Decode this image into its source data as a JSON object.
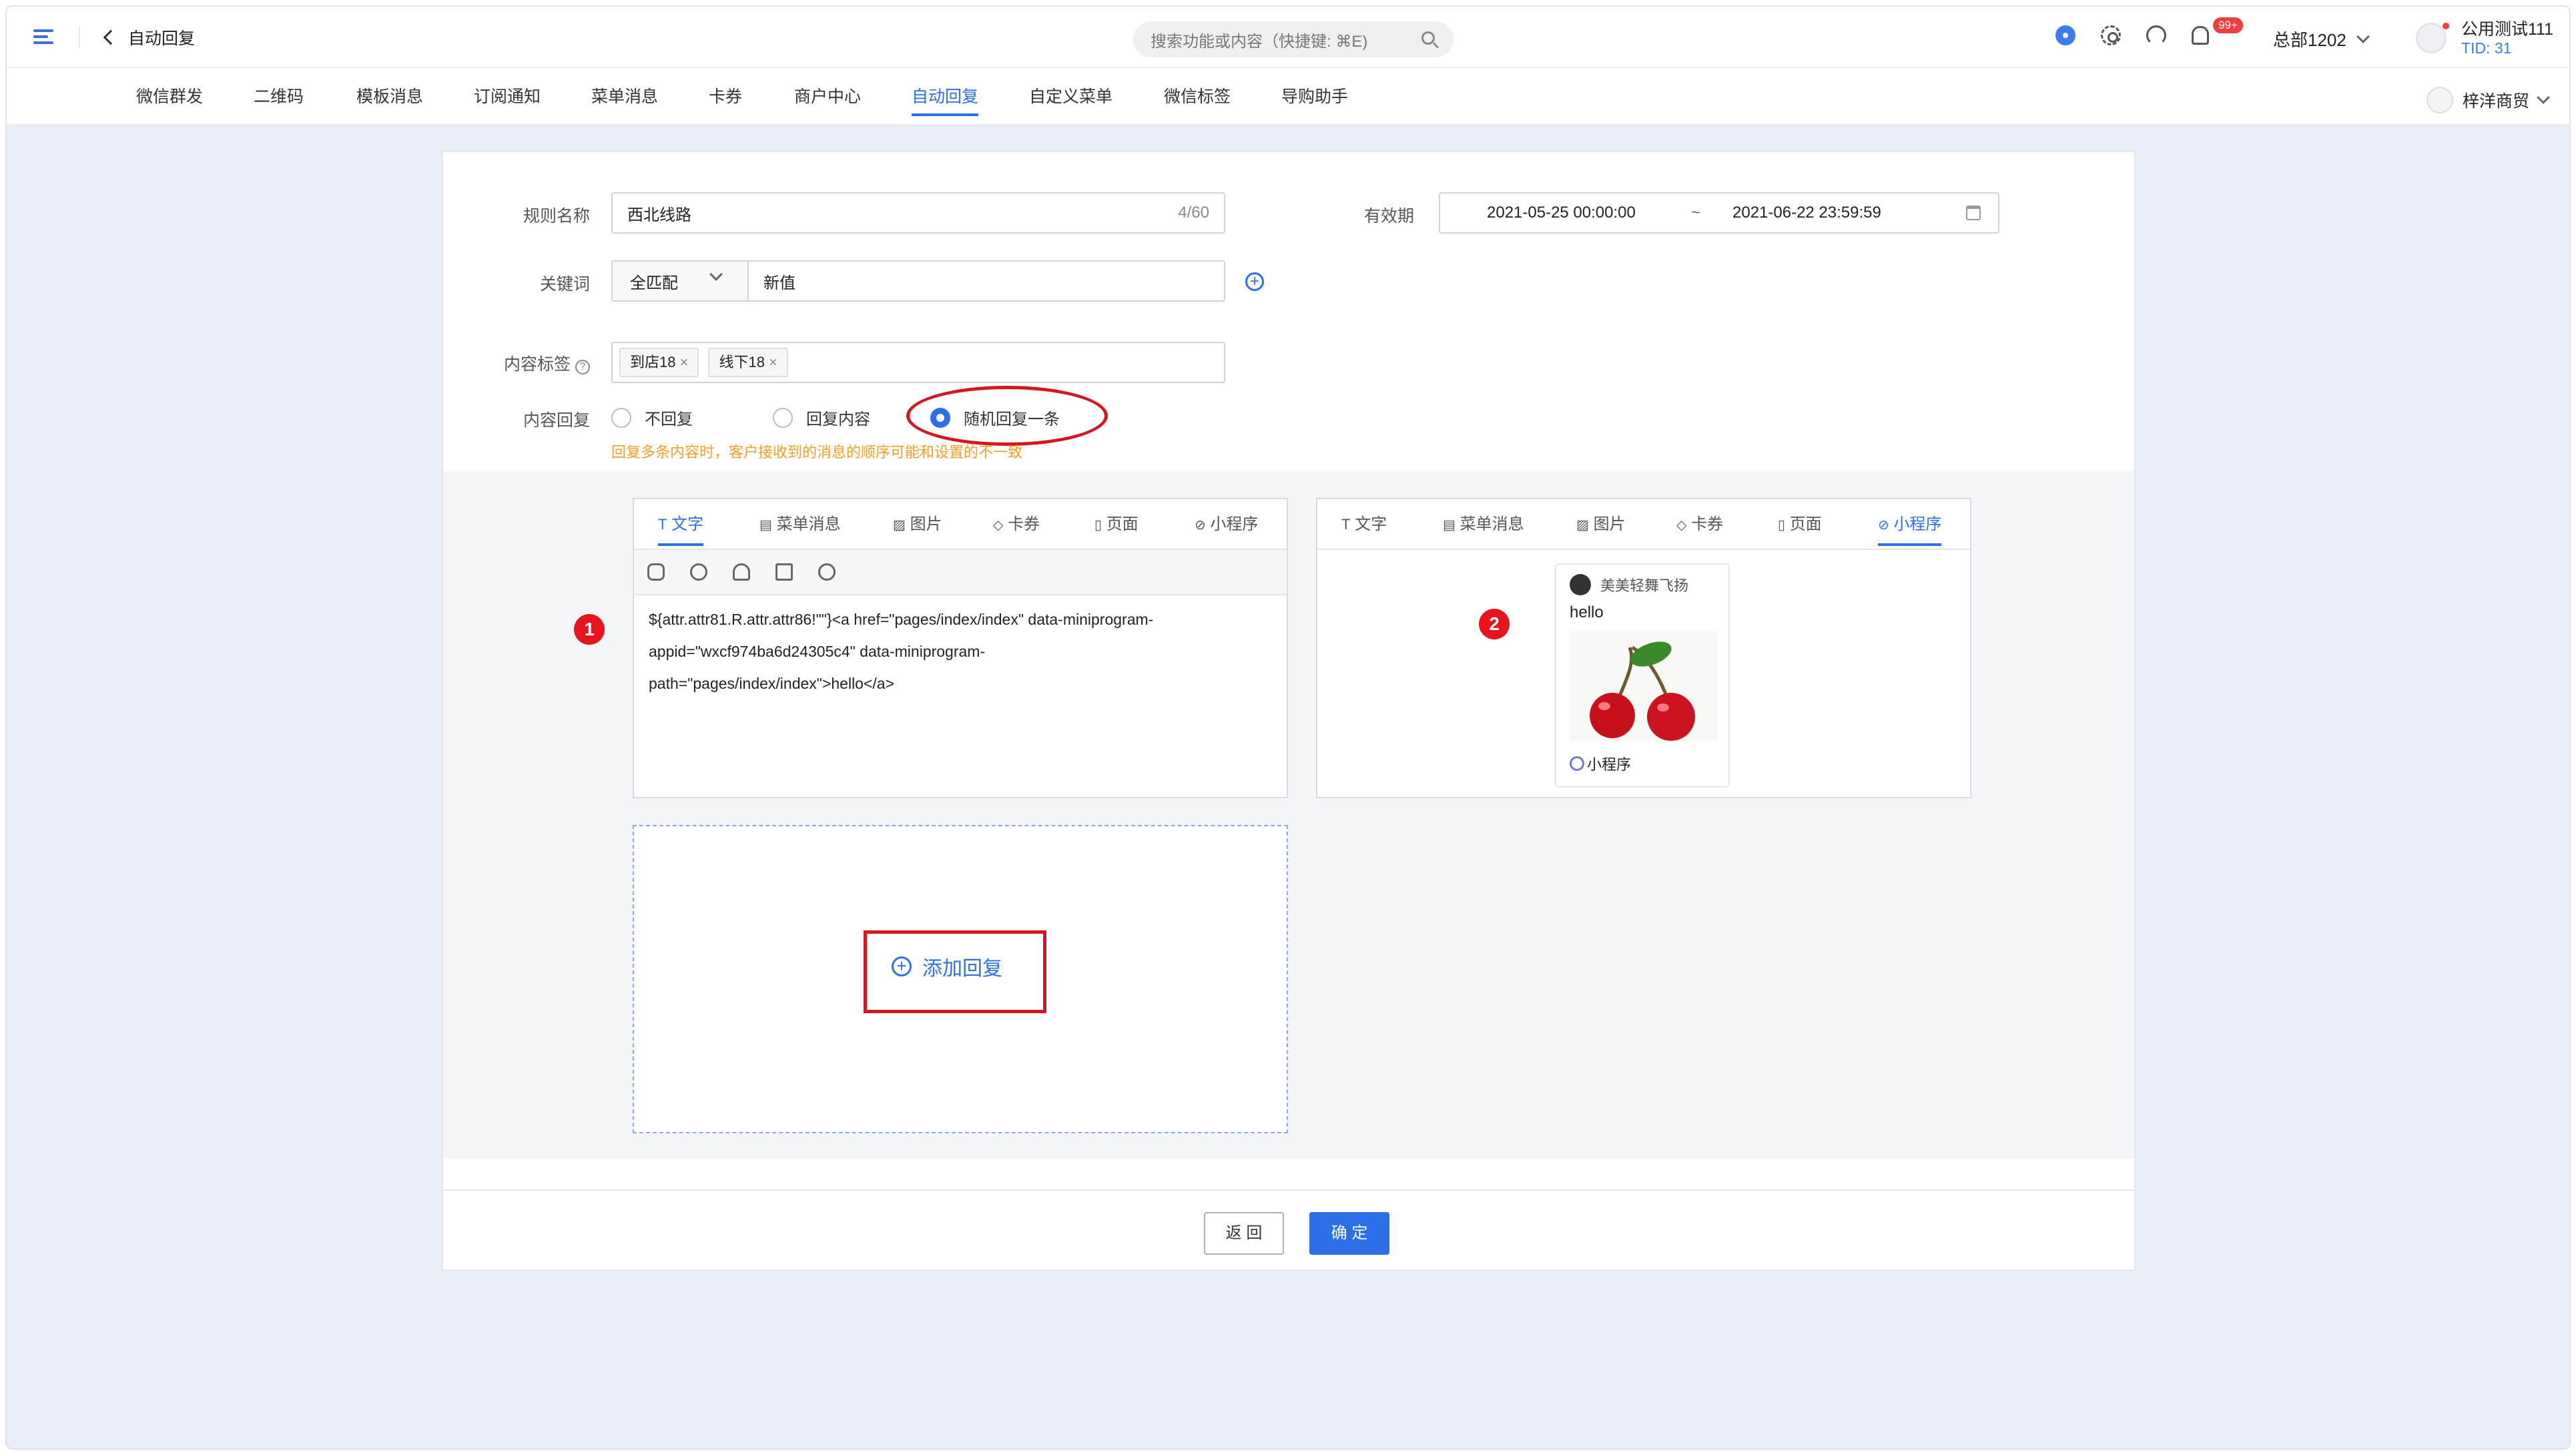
{
  "topbar": {
    "back_title": "自动回复",
    "search_placeholder": "搜索功能或内容（快捷键: ⌘E)",
    "notification_badge": "99+",
    "org_name": "总部1202",
    "user_name": "公用测试111",
    "user_tid": "TID: 31"
  },
  "nav": {
    "tabs": [
      "微信群发",
      "二维码",
      "模板消息",
      "订阅通知",
      "菜单消息",
      "卡券",
      "商户中心",
      "自动回复",
      "自定义菜单",
      "微信标签",
      "导购助手"
    ],
    "active_tab": "自动回复",
    "store_name": "梓洋商贸"
  },
  "form": {
    "rule_name_label": "规则名称",
    "rule_name_value": "西北线路",
    "rule_name_counter": "4/60",
    "validity_label": "有效期",
    "validity_start": "2021-05-25 00:00:00",
    "validity_sep": "~",
    "validity_end": "2021-06-22 23:59:59",
    "keyword_label": "关键词",
    "keyword_match": "全匹配",
    "keyword_value": "新值",
    "tags_label": "内容标签",
    "tags": [
      "到店18",
      "线下18"
    ],
    "reply_label": "内容回复",
    "reply_options": [
      "不回复",
      "回复内容",
      "随机回复一条"
    ],
    "reply_selected": "随机回复一条",
    "reply_hint": "回复多条内容时，客户接收到的消息的顺序可能和设置的不一致"
  },
  "editor_tabs": [
    "文字",
    "菜单消息",
    "图片",
    "卡券",
    "页面",
    "小程序"
  ],
  "card1": {
    "number": "1",
    "active_tab": "文字",
    "tools": [
      "link-icon",
      "miniprogram-icon",
      "user-icon",
      "form-icon",
      "emoji-icon"
    ],
    "text_lines": [
      "${attr.attr81.R.attr.attr86!\"\"}<a href=\"pages/index/index\" data-miniprogram-",
      "appid=\"wxcf974ba6d24305c4\" data-miniprogram-",
      "path=\"pages/index/index\">hello</a>"
    ]
  },
  "card2": {
    "number": "2",
    "active_tab": "小程序",
    "mp_name": "美美轻舞飞扬",
    "mp_title": "hello",
    "mp_footer": "小程序"
  },
  "add_reply_label": "添加回复",
  "actions": {
    "back": "返 回",
    "confirm": "确 定"
  },
  "colors": {
    "primary": "#2c6fe8",
    "annotation_red": "#d8151c",
    "hint_orange": "#f0a020"
  }
}
